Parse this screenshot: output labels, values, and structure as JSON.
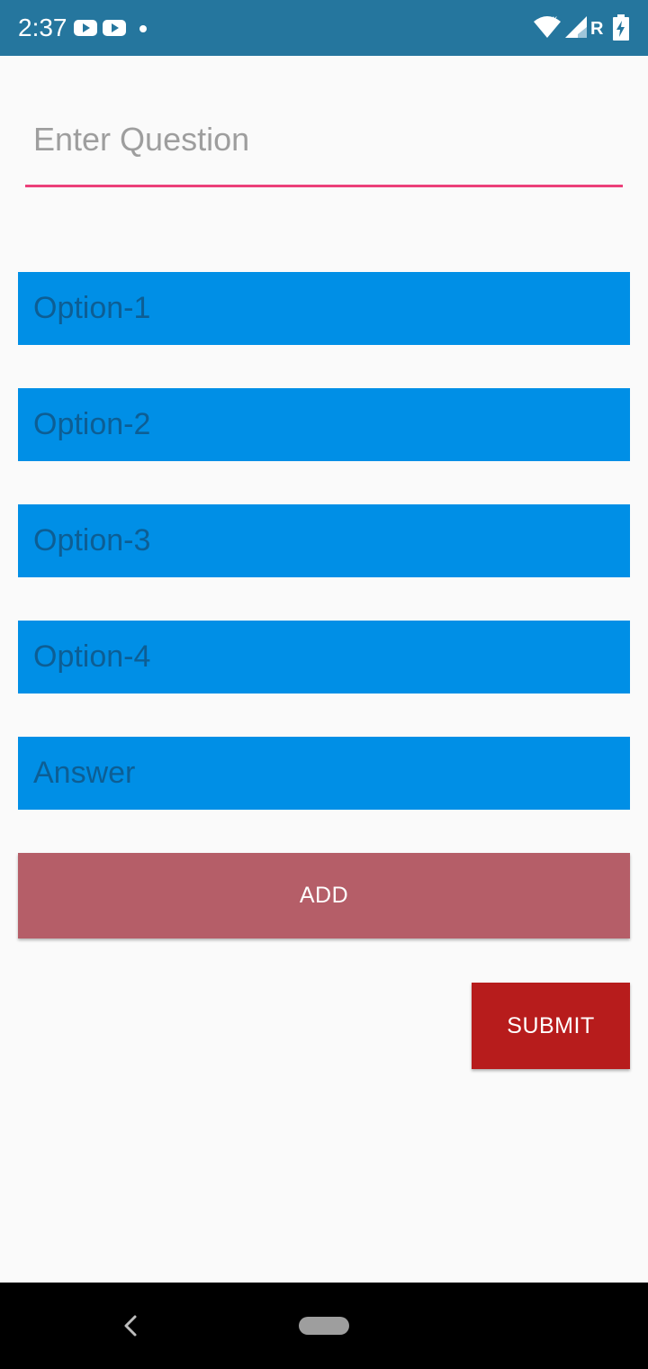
{
  "status_bar": {
    "time": "2:37",
    "icons": [
      "youtube-icon",
      "youtube-icon",
      "dot-icon",
      "wifi-icon",
      "signal-icon",
      "battery-charging-icon"
    ],
    "roaming_label": "R",
    "background": "#25769e"
  },
  "form": {
    "question_placeholder": "Enter Question",
    "question_value": "",
    "underline_color": "#ec407a",
    "options": [
      {
        "placeholder": "Option-1",
        "value": ""
      },
      {
        "placeholder": "Option-2",
        "value": ""
      },
      {
        "placeholder": "Option-3",
        "value": ""
      },
      {
        "placeholder": "Option-4",
        "value": ""
      }
    ],
    "answer_placeholder": "Answer",
    "answer_value": "",
    "field_color": "#008fe6"
  },
  "actions": {
    "add_label": "ADD",
    "add_color": "#b55e68",
    "submit_label": "SUBMIT",
    "submit_color": "#b71c1c"
  },
  "nav_bar": {
    "icons": [
      "back-icon",
      "home-pill-icon"
    ]
  }
}
